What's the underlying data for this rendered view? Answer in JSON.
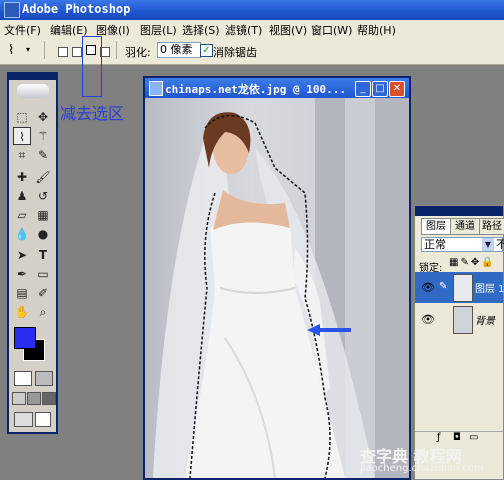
{
  "app": {
    "title": "Adobe Photoshop"
  },
  "menu": [
    "文件(F)",
    "编辑(E)",
    "图像(I)",
    "图层(L)",
    "选择(S)",
    "滤镜(T)",
    "视图(V)",
    "窗口(W)",
    "帮助(H)"
  ],
  "options": {
    "feather_label": "羽化:",
    "feather_value": "0 像素",
    "antialias_label": "消除锯齿",
    "antialias_checked": true
  },
  "annotation": {
    "subtract_label": "减去选区"
  },
  "document": {
    "title": "chinaps.net龙依.jpg @ 100..."
  },
  "layers": {
    "tabs": [
      "图层",
      "通道",
      "路径"
    ],
    "blend_mode": "正常",
    "opacity_label": "不",
    "lock_label": "锁定:",
    "rows": [
      {
        "name": "图层 1",
        "selected": true
      },
      {
        "name": "背景",
        "selected": false
      }
    ]
  },
  "toolbox": {
    "icons": [
      "marquee-icon",
      "move-icon",
      "polygon-lasso-icon",
      "magic-wand-icon",
      "crop-icon",
      "slice-icon",
      "healing-icon",
      "brush-icon",
      "stamp-icon",
      "history-brush-icon",
      "eraser-icon",
      "gradient-icon",
      "blur-icon",
      "dodge-icon",
      "path-select-icon",
      "type-icon",
      "pen-icon",
      "shape-icon",
      "notes-icon",
      "eyedropper-icon",
      "hand-icon",
      "zoom-icon"
    ]
  },
  "colors": {
    "foreground": "#2a2ef0",
    "background": "#000000",
    "accent": "#2a3fd6",
    "arrow": "#2a52e8"
  },
  "watermark": {
    "line1": "查字典 教程网",
    "line2": "jiaocheng.chazidian.com"
  }
}
